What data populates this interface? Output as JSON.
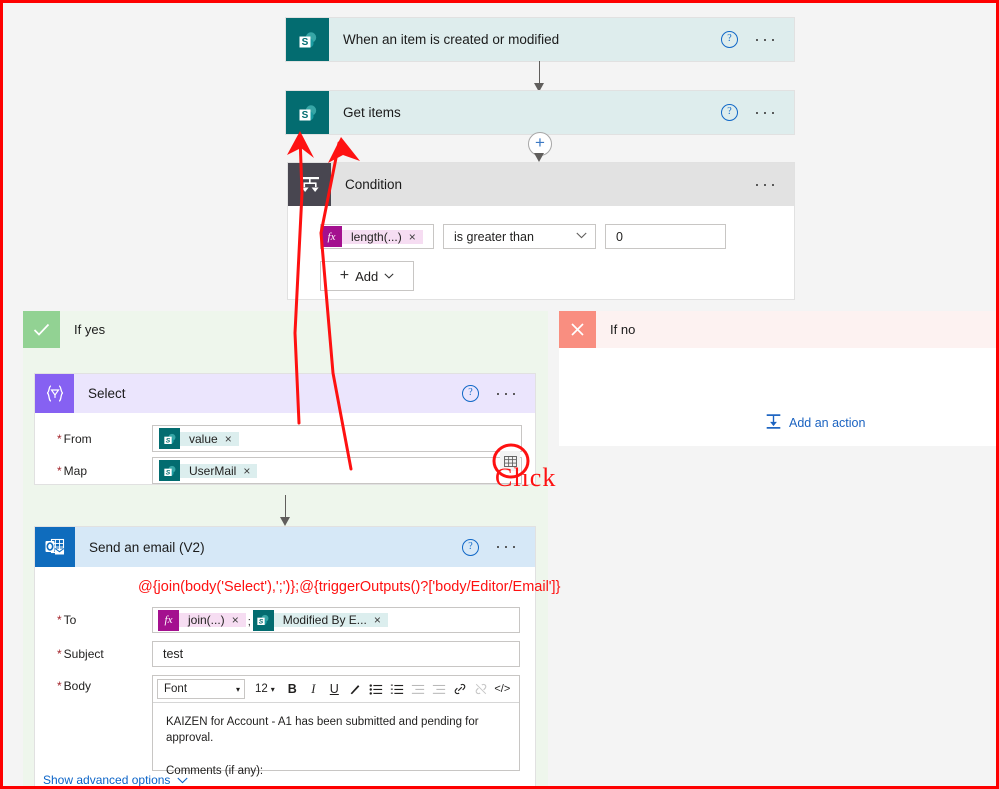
{
  "canvas": {
    "border_color": "#fe0000",
    "background": "#f4f4f4"
  },
  "nodes": {
    "trigger": {
      "title": "When an item is created or modified",
      "icon": "sharepoint-icon",
      "help": "?",
      "menu": "···"
    },
    "get_items": {
      "title": "Get items",
      "icon": "sharepoint-icon",
      "help": "?",
      "menu": "···"
    },
    "condition": {
      "title": "Condition",
      "icon": "condition-icon",
      "menu": "···",
      "expression": {
        "chip_icon": "fx",
        "chip_label": "length(...)",
        "chip_remove": "×"
      },
      "operator": "is greater than",
      "operator_chevron": "⌄",
      "value": "0",
      "add_button": {
        "plus": "+",
        "label": "Add",
        "chevron": "⌄"
      }
    },
    "if_yes": {
      "label": "If yes",
      "badge": "check-icon"
    },
    "if_no": {
      "label": "If no",
      "badge": "close-icon",
      "add_action": "Add an action",
      "add_action_icon": "add-action-icon"
    },
    "select": {
      "title": "Select",
      "icon": "select-icon",
      "help": "?",
      "menu": "···",
      "fields": [
        {
          "label": "From",
          "required": "*",
          "chip_icon": "sharepoint-icon",
          "chip_label": "value",
          "chip_remove": "×"
        },
        {
          "label": "Map",
          "required": "*",
          "chip_icon": "sharepoint-icon",
          "chip_label": "UserMail",
          "chip_remove": "×"
        }
      ],
      "map_grid_icon": "grid-toggle-icon"
    },
    "send_email": {
      "title": "Send an email (V2)",
      "icon": "outlook-icon",
      "help": "?",
      "menu": "···",
      "to": {
        "label": "To",
        "required": "*",
        "chips": [
          {
            "icon": "fx",
            "label": "join(...)",
            "remove": "×",
            "style": "fx"
          },
          {
            "icon": "sharepoint-icon",
            "label": "Modified By E...",
            "remove": "×",
            "style": "sp"
          }
        ],
        "separator": ";"
      },
      "subject": {
        "label": "Subject",
        "required": "*",
        "value": "test"
      },
      "body": {
        "label": "Body",
        "required": "*",
        "toolbar": {
          "font_name": "Font",
          "font_chevron": "▾",
          "font_size": "12",
          "size_chevron": "▾",
          "bold": "B",
          "italic": "I",
          "underline": "U",
          "text_color": "✐",
          "bullet_list": "≣",
          "number_list": "≡",
          "outdent": "≡",
          "indent": "≡",
          "link": "🔗",
          "unlink": "🔗",
          "code": "</>"
        },
        "lines": [
          "KAIZEN for Account - A1 has been submitted and pending for approval.",
          "Comments (if any):"
        ]
      },
      "show_advanced": "Show advanced options",
      "show_advanced_chevron": "⌄"
    }
  },
  "annotations": {
    "expression_note": "@{join(body('Select'),';')};@{triggerOutputs()?['body/Editor/Email']}",
    "click_label": "Click",
    "arrow_color": "#fe1111"
  }
}
